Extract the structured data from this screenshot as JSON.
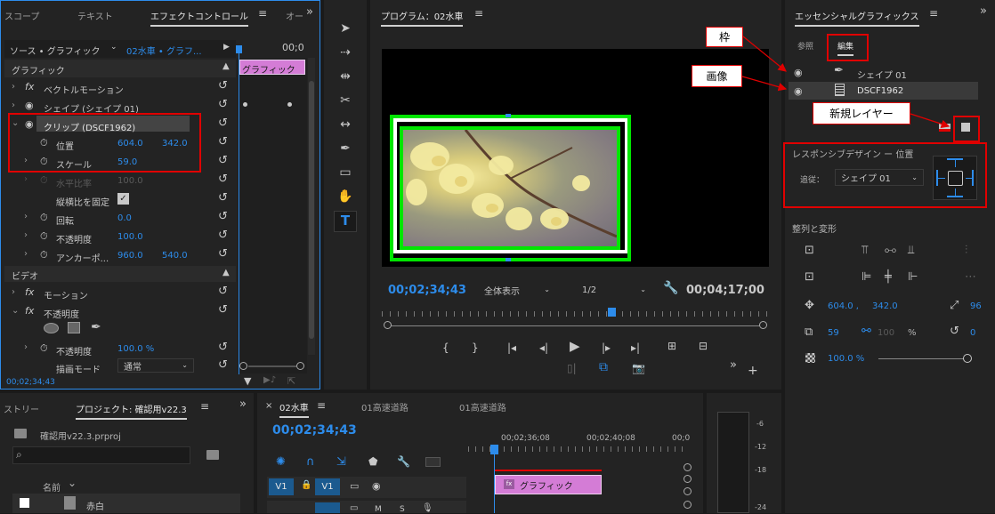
{
  "effect_panel": {
    "tabs": [
      "スコープ",
      "テキスト",
      "エフェクトコントロール",
      "オー"
    ],
    "source_label": "ソース • グラフィック",
    "source_selector": "02水車 • グラフ...",
    "timecode_right": "00;0",
    "section_graphic": "グラフィック",
    "clip_bar_label": "グラフィック",
    "vector_motion": "ベクトルモーション",
    "shape_layer": "シェイプ (シェイプ 01)",
    "clip_layer": "クリップ (DSCF1962)",
    "position_label": "位置",
    "position_x": "604.0",
    "position_y": "342.0",
    "scale_label": "スケール",
    "scale_value": "59.0",
    "scale_w_label": "水平比率",
    "scale_w_value": "100.0",
    "uniform_label": "縦横比を固定",
    "rotation_label": "回転",
    "rotation_value": "0.0",
    "opacity_label": "不透明度",
    "opacity_value": "100.0",
    "anchor_label": "アンカーポ...",
    "anchor_x": "960.0",
    "anchor_y": "540.0",
    "section_video": "ビデオ",
    "motion_label": "モーション",
    "opacity_group": "不透明度",
    "opacity2_label": "不透明度",
    "opacity2_value": "100.0 %",
    "blend_label": "描画モード",
    "blend_value": "通常",
    "footer_timecode": "00;02;34;43"
  },
  "program_monitor": {
    "title": "プログラム：02水車",
    "current_time": "00;02;34;43",
    "fit_select": "全体表示",
    "quality_select": "1/2",
    "duration": "00;04;17;00"
  },
  "essential_graphics": {
    "title": "エッセンシャルグラフィックス",
    "tab_browse": "参照",
    "tab_edit": "編集",
    "layer_shape": "シェイプ 01",
    "layer_image": "DSCF1962",
    "responsive_title": "レスポンシブデザイン ー 位置",
    "follow_label": "追従：",
    "follow_value": "シェイプ 01",
    "align_title": "整列と変形",
    "pos_x": "604.0 ,",
    "pos_y": "342.0",
    "anchor_partial": "96",
    "scale_value": "59",
    "scale_h": "100",
    "scale_unit": "%",
    "rotation_value": "0",
    "opacity_value": "100.0 %",
    "opacity_fraction": 1.0
  },
  "callouts": {
    "frame": "枠",
    "image": "画像",
    "new_layer": "新規レイヤー"
  },
  "project_panel": {
    "tab_left": "ストリー",
    "tab_project": "プロジェクト: 確認用v22.3",
    "file_name": "確認用v22.3.prproj",
    "col_name": "名前",
    "item_name": "赤白"
  },
  "timeline": {
    "tab_1": "02水車",
    "tab_2": "01高速道路",
    "tab_3": "01高速道路",
    "current_time": "00;02;34;43",
    "ruler_1": "00;02;36;08",
    "ruler_2": "00;02;40;08",
    "ruler_3": "00;0",
    "track_v1_src": "V1",
    "track_v1": "V1",
    "clip_label": "グラフィック",
    "row2_m": "M",
    "row2_s": "S"
  },
  "meter": {
    "labels": [
      "-6",
      "-12",
      "-18",
      "-24"
    ]
  }
}
